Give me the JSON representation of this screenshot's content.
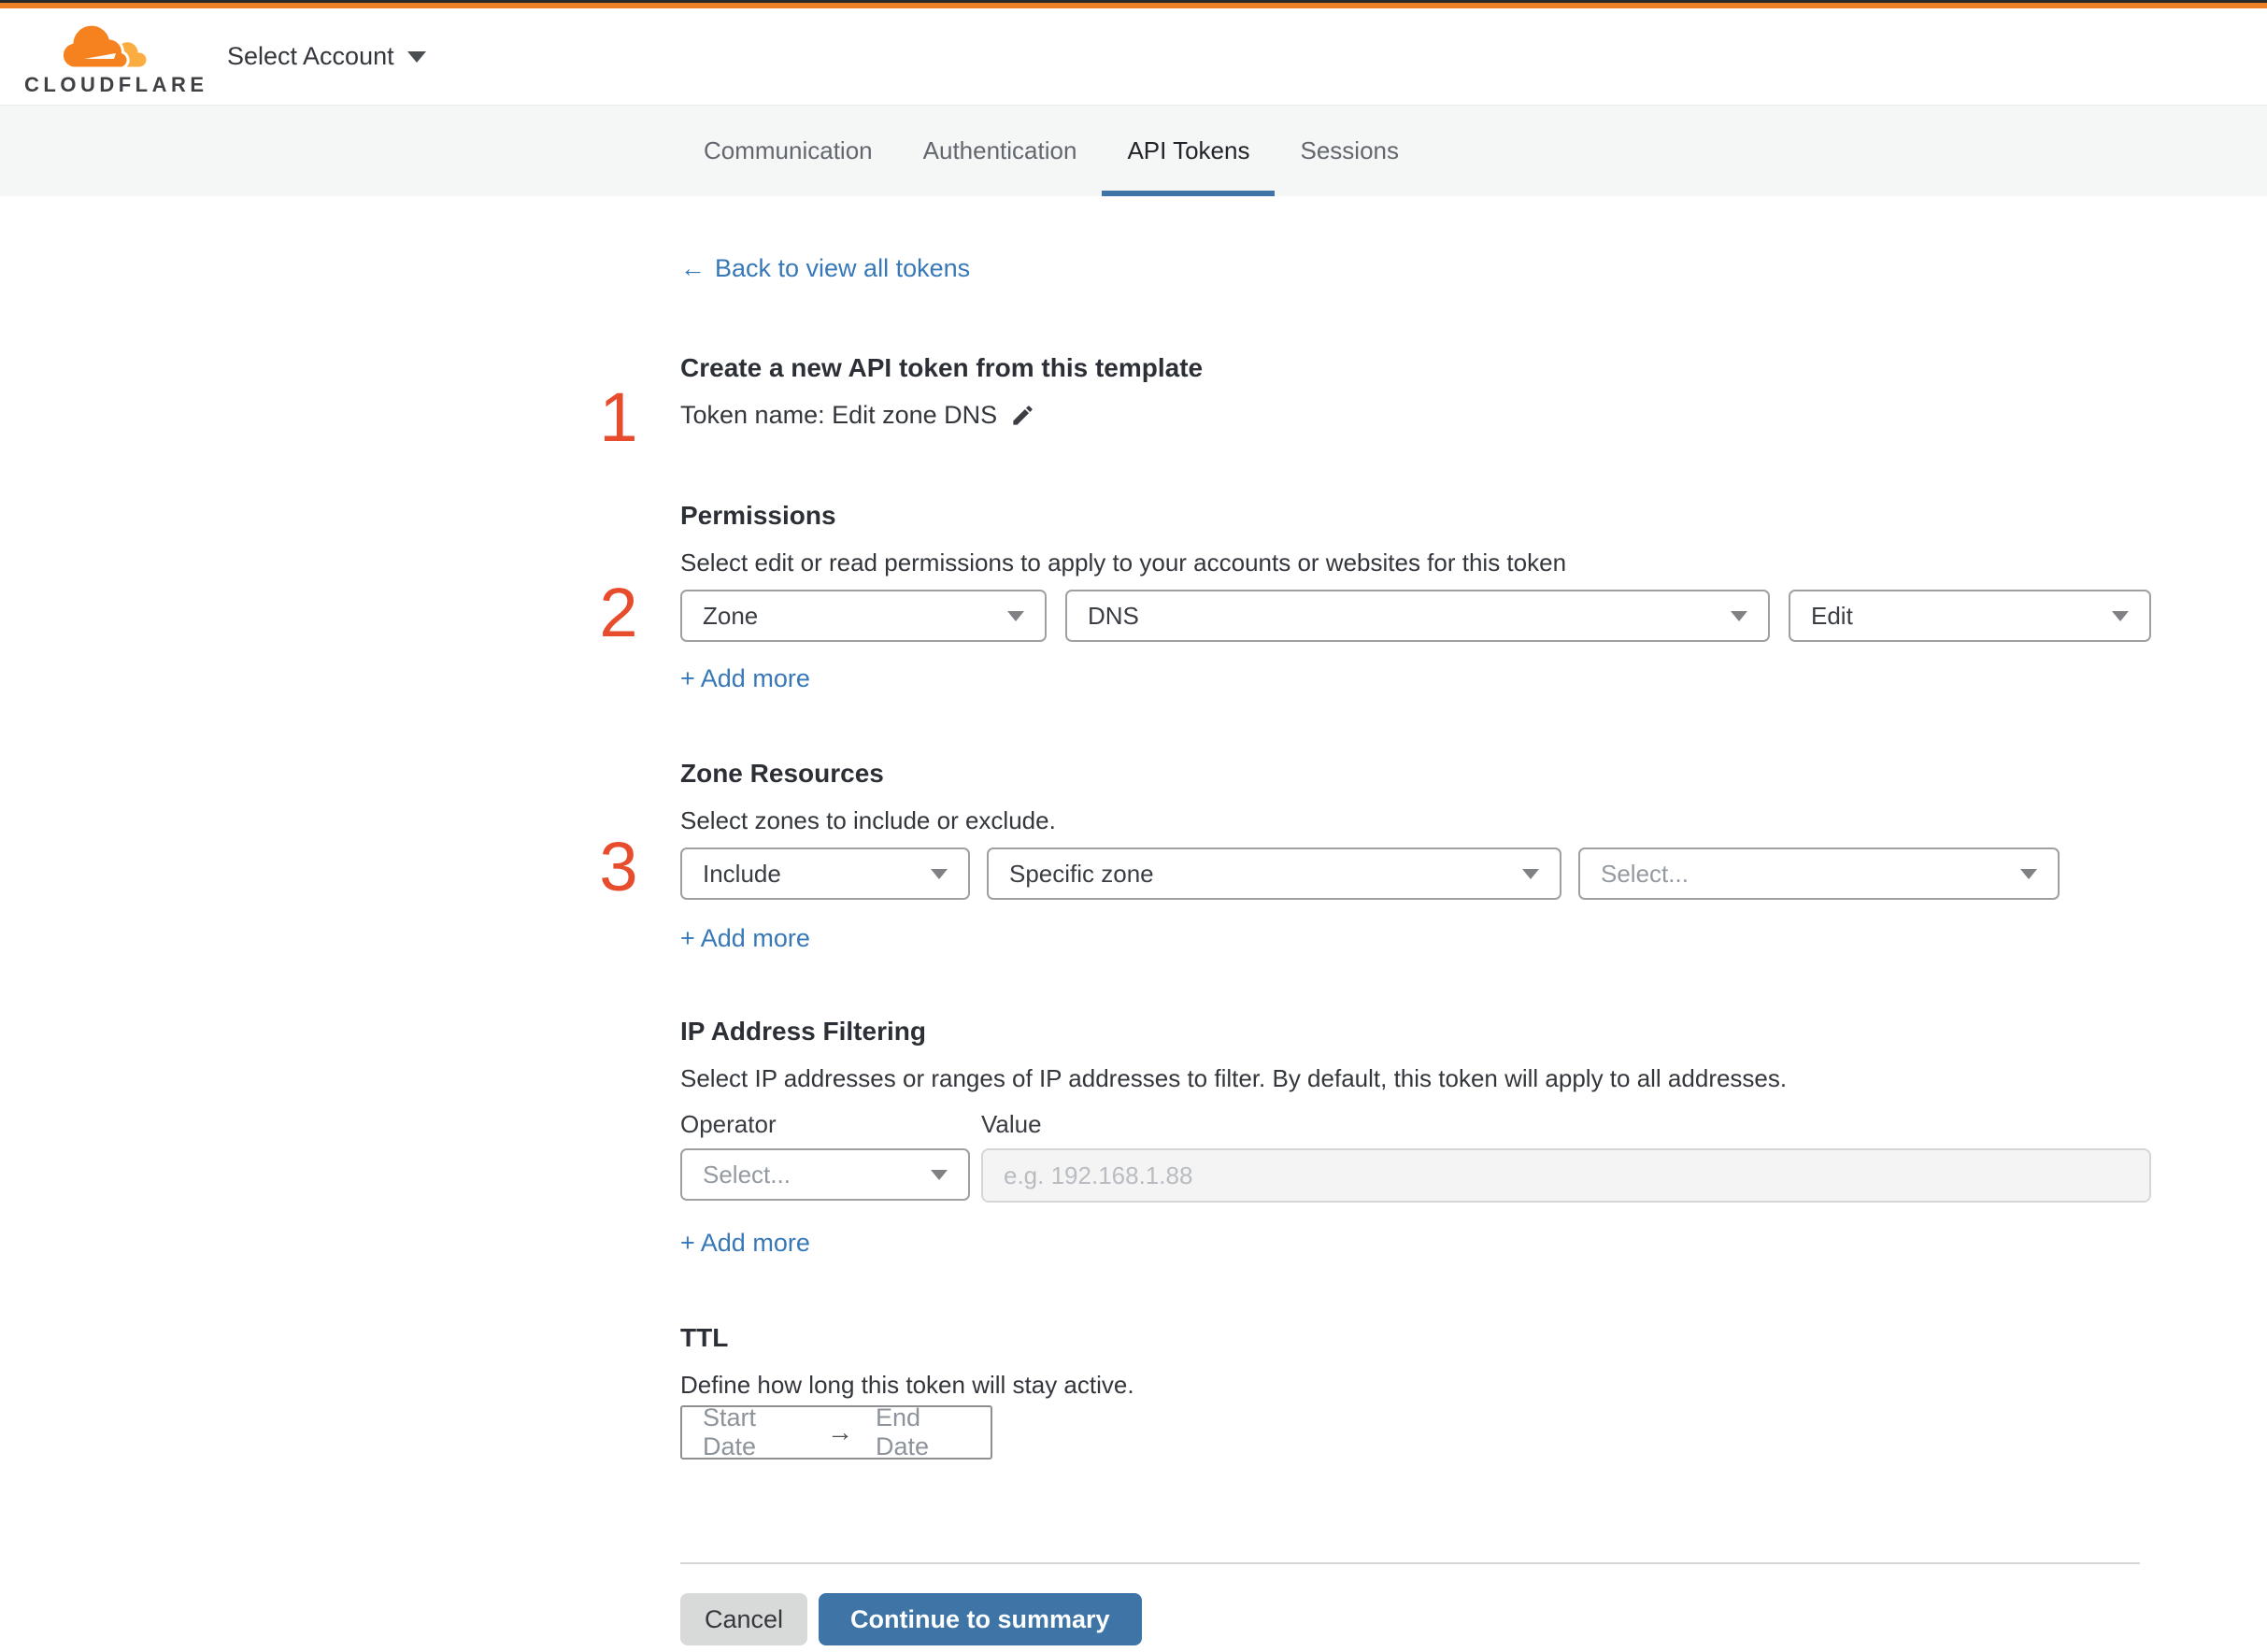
{
  "colors": {
    "accent_orange": "#ee8126",
    "link_blue": "#3778b8",
    "button_blue": "#3e74a6",
    "step_red": "#e74c2c",
    "tabbar_bg": "#f5f6f6"
  },
  "header": {
    "logo_text": "CLOUDFLARE",
    "account_selector": "Select Account"
  },
  "tabs": [
    {
      "label": "Communication",
      "active": false
    },
    {
      "label": "Authentication",
      "active": false
    },
    {
      "label": "API Tokens",
      "active": true
    },
    {
      "label": "Sessions",
      "active": false
    }
  ],
  "back_link": {
    "arrow": "←",
    "label": "Back to view all tokens"
  },
  "steps": {
    "s1": "1",
    "s2": "2",
    "s3": "3"
  },
  "token": {
    "title": "Create a new API token from this template",
    "name_line": "Token name: Edit zone DNS"
  },
  "permissions": {
    "title": "Permissions",
    "subtitle": "Select edit or read permissions to apply to your accounts or websites for this token",
    "selects": [
      {
        "value": "Zone"
      },
      {
        "value": "DNS"
      },
      {
        "value": "Edit"
      }
    ],
    "add_more": "+ Add more"
  },
  "zone_resources": {
    "title": "Zone Resources",
    "subtitle": "Select zones to include or exclude.",
    "selects": [
      {
        "value": "Include"
      },
      {
        "value": "Specific zone"
      },
      {
        "value": "Select..."
      }
    ],
    "add_more": "+ Add more"
  },
  "ip_filtering": {
    "title": "IP Address Filtering",
    "subtitle": "Select IP addresses or ranges of IP addresses to filter. By default, this token will apply to all addresses.",
    "operator_label": "Operator",
    "value_label": "Value",
    "operator_placeholder": "Select...",
    "value_placeholder": "e.g. 192.168.1.88",
    "add_more": "+ Add more"
  },
  "ttl": {
    "title": "TTL",
    "subtitle": "Define how long this token will stay active.",
    "start_placeholder": "Start Date",
    "arrow": "→",
    "end_placeholder": "End Date"
  },
  "footer": {
    "cancel": "Cancel",
    "continue": "Continue to summary"
  }
}
